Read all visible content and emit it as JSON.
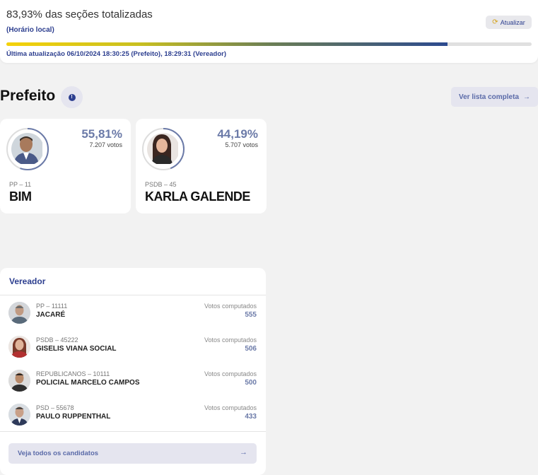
{
  "header": {
    "pct_title": "83,93% das seções totalizadas",
    "local_time": "(Horário local)",
    "refresh_label": "Atualizar",
    "progress_fraction": 0.8393,
    "last_update": "Última atualização 06/10/2024 18:30:25 (Prefeito), 18:29:31 (Vereador)"
  },
  "prefeito": {
    "title": "Prefeito",
    "list_button": "Ver lista completa",
    "candidates": [
      {
        "pct": "55,81%",
        "votes": "7.207 votos",
        "party": "PP – 11",
        "name": "BIM",
        "share": 0.5581
      },
      {
        "pct": "44,19%",
        "votes": "5.707 votos",
        "party": "PSDB – 45",
        "name": "KARLA GALENDE",
        "share": 0.4419
      }
    ]
  },
  "vereador": {
    "title": "Vereador",
    "votes_label": "Votos computados",
    "rows": [
      {
        "party": "PP – 11111",
        "name": "JACARÉ",
        "votes": "555"
      },
      {
        "party": "PSDB – 45222",
        "name": "GISELIS VIANA SOCIAL",
        "votes": "506"
      },
      {
        "party": "REPUBLICANOS – 10111",
        "name": "POLICIAL MARCELO CAMPOS",
        "votes": "500"
      },
      {
        "party": "PSD – 55678",
        "name": "PAULO RUPPENTHAL",
        "votes": "433"
      }
    ],
    "all_button": "Veja todos os candidatos",
    "arrow": "→"
  },
  "colors": {
    "accent": "#2c3e8f",
    "muted_accent": "#6b7aa8",
    "progress_start": "#f5d20a",
    "progress_end": "#2c4a8f"
  }
}
